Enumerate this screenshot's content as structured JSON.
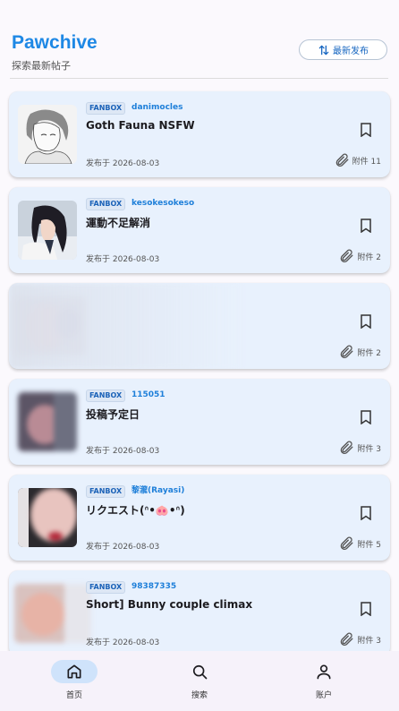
{
  "header": {
    "title": "Pawchive",
    "subtitle": "探索最新帖子",
    "sort_label": "最新发布"
  },
  "posts": [
    {
      "tag": "FANBOX",
      "author": "danimocles",
      "title": "Goth Fauna NSFW",
      "date": "发布于 2026-08-03",
      "attachments": "附件 11"
    },
    {
      "tag": "FANBOX",
      "author": "kesokesokeso",
      "title": "運動不足解消",
      "date": "发布于 2026-08-03",
      "attachments": "附件 2"
    },
    {
      "tag": "",
      "author": "",
      "title": "",
      "date": "",
      "attachments": "附件 2"
    },
    {
      "tag": "FANBOX",
      "author": "115051",
      "title": "投稿予定日",
      "date": "发布于 2026-08-03",
      "attachments": "附件 3"
    },
    {
      "tag": "FANBOX",
      "author": "黎瀧(Rayasi)",
      "title": "リクエスト(ᐢ•🐽•ᐢ)",
      "date": "发布于 2026-08-03",
      "attachments": "附件 5"
    },
    {
      "tag": "FANBOX",
      "author": "98387335",
      "title": "Short] Bunny couple climax",
      "date": "发布于 2026-08-03",
      "attachments": "附件 3"
    }
  ],
  "nav": {
    "home": "首页",
    "search": "搜索",
    "account": "账户"
  },
  "colors": {
    "accent": "#1e88e5",
    "card_bg": "#e8f1fd",
    "nav_active": "#cfe3fb"
  }
}
